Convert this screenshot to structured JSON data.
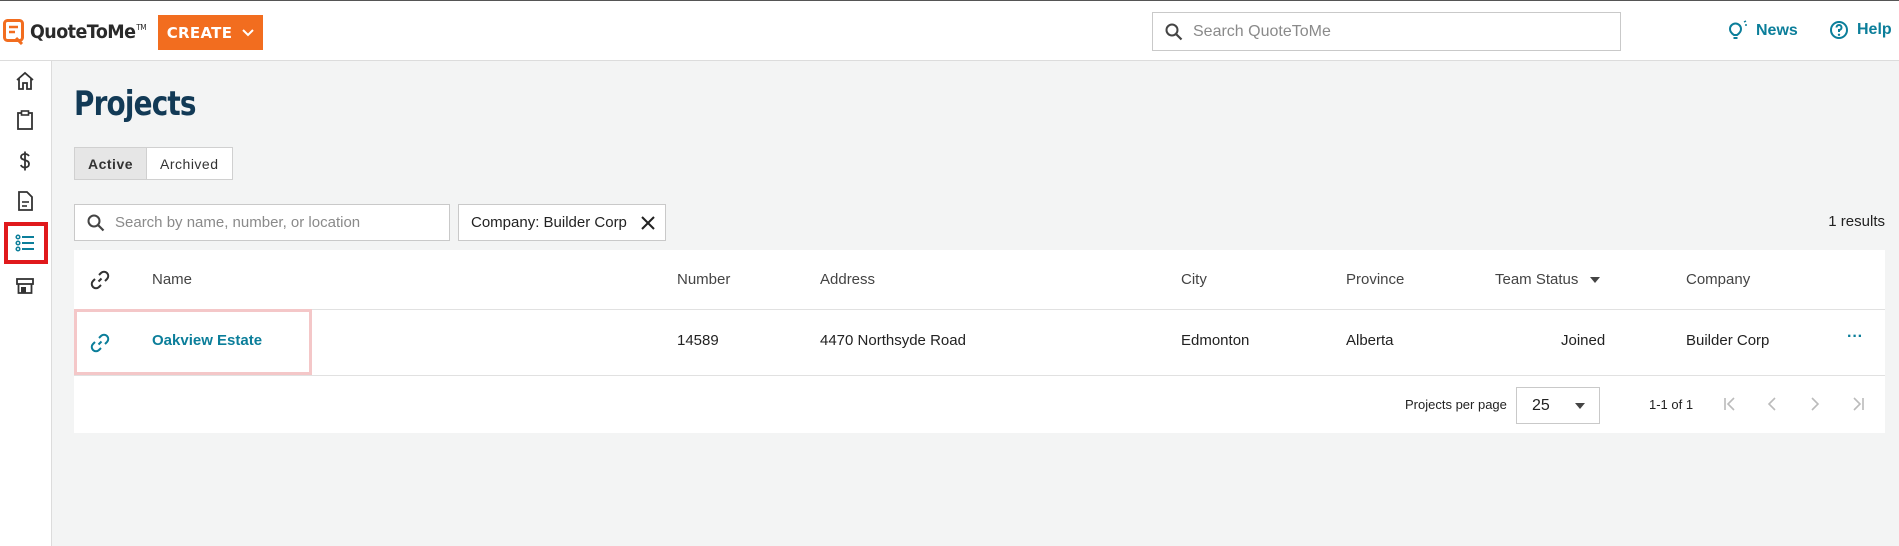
{
  "header": {
    "logo_text": "QuoteToMe",
    "logo_tm": "TM",
    "create_label": "CREATE",
    "search_placeholder": "Search QuoteToMe",
    "news_label": "News",
    "help_label": "Help"
  },
  "colors": {
    "brand_orange": "#f26d1f",
    "link_teal": "#0b7e9a",
    "title_navy": "#123a56",
    "active_nav_outline": "#e0191c"
  },
  "sidebar": {
    "items": [
      {
        "icon": "home-icon"
      },
      {
        "icon": "clipboard-icon"
      },
      {
        "icon": "dollar-icon"
      },
      {
        "icon": "document-icon"
      },
      {
        "icon": "list-icon",
        "active": true
      },
      {
        "icon": "storefront-icon"
      }
    ]
  },
  "main": {
    "title": "Projects",
    "tabs": [
      {
        "label": "Active",
        "active": true
      },
      {
        "label": "Archived",
        "active": false
      }
    ],
    "search_placeholder": "Search by name, number, or location",
    "filter_chip": "Company: Builder Corp",
    "results": "1 results"
  },
  "table": {
    "columns": [
      "Name",
      "Number",
      "Address",
      "City",
      "Province",
      "Team Status",
      "Company"
    ],
    "rows": [
      {
        "name": "Oakview Estate",
        "number": "14589",
        "address": "4470 Northsyde Road",
        "city": "Edmonton",
        "province": "Alberta",
        "team_status": "Joined",
        "company": "Builder Corp",
        "menu": "···"
      }
    ]
  },
  "pagination": {
    "per_page_label": "Projects per page",
    "per_page_value": "25",
    "range": "1-1 of 1"
  }
}
